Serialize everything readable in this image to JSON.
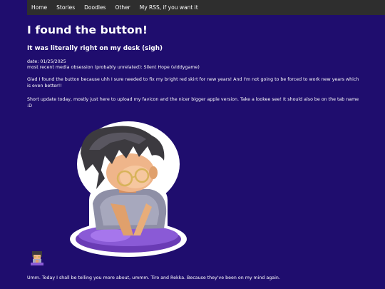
{
  "nav": {
    "items": [
      {
        "label": "Home"
      },
      {
        "label": "Stories"
      },
      {
        "label": "Doodles"
      },
      {
        "label": "Other"
      },
      {
        "label": "My RSS, if you want it"
      }
    ]
  },
  "post": {
    "title": "I found the button!",
    "subtitle": "It was literally right on my desk (sigh)",
    "date_line": "date: 01/25/2025",
    "obsession_line": "most recent media obsession (probably unrelated): Silent Hope (viddygame)",
    "paragraph_1": "Glad I found the button because uhh I sure needed to fix my bright red skirt for new years! And I'm not going to be forced to work new years which is even better!!",
    "paragraph_2": "Short update today, mostly just here to upload my favicon and the nicer bigger apple version. Take a lookee see! It should also be on the tab name :D",
    "paragraph_3": "Umm. Today I shall be telling you more about, ummm. Tiro and Rekka. Because they've been on my mind again."
  },
  "colors": {
    "background": "#1f0d6e",
    "navbar": "#2e2e2e",
    "text": "#ffffff"
  }
}
